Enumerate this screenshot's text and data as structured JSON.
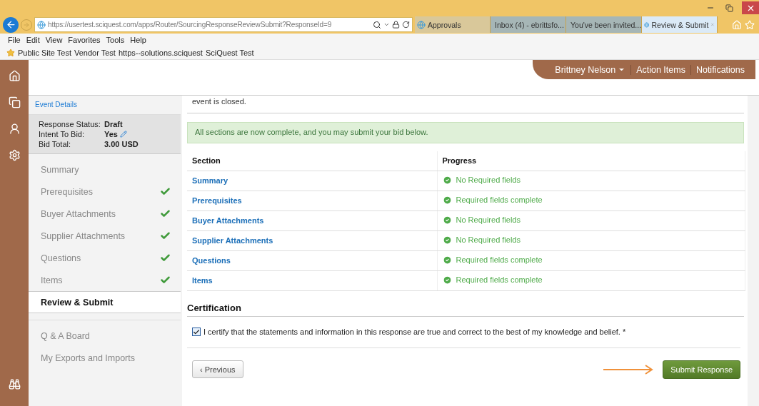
{
  "browser": {
    "address": "https://usertest.sciquest.com/apps/Router/SourcingResponseReviewSubmit?ResponseId=9",
    "tabs": [
      {
        "label": "Approvals",
        "kind": "ie",
        "selected": false
      },
      {
        "label": "Inbox (4) - ebrittsfo...",
        "kind": "mail",
        "selected": false
      },
      {
        "label": "You've been invited...",
        "kind": "mail",
        "selected": false
      },
      {
        "label": "Review & Submit",
        "kind": "ie",
        "selected": true
      }
    ],
    "menu": [
      "File",
      "Edit",
      "View",
      "Favorites",
      "Tools",
      "Help"
    ],
    "favorites": [
      "Public Site Test",
      "Vendor Test",
      "https--solutions.sciquest",
      "SciQuest Test"
    ]
  },
  "header": {
    "user": "Brittney Nelson",
    "links": [
      "Action Items",
      "Notifications"
    ]
  },
  "sidebar": {
    "event_details": "Event Details",
    "status": [
      {
        "label": "Response Status:",
        "value": "Draft",
        "editable": false
      },
      {
        "label": "Intent To Bid:",
        "value": "Yes",
        "editable": true
      },
      {
        "label": "Bid Total:",
        "value": "3.00 USD",
        "editable": false
      }
    ],
    "steps": [
      {
        "label": "Summary",
        "complete": false,
        "selected": false
      },
      {
        "label": "Prerequisites",
        "complete": true,
        "selected": false
      },
      {
        "label": "Buyer Attachments",
        "complete": true,
        "selected": false
      },
      {
        "label": "Supplier Attachments",
        "complete": true,
        "selected": false
      },
      {
        "label": "Questions",
        "complete": true,
        "selected": false
      },
      {
        "label": "Items",
        "complete": true,
        "selected": false
      },
      {
        "label": "Review & Submit",
        "complete": false,
        "selected": true
      }
    ],
    "links": [
      "Q & A Board",
      "My Exports and Imports"
    ]
  },
  "main": {
    "intro": "event is closed.",
    "alert": "All sections are now complete, and you may submit your bid below.",
    "table": {
      "columns": [
        "Section",
        "Progress"
      ],
      "rows": [
        {
          "section": "Summary",
          "progress": "No Required fields"
        },
        {
          "section": "Prerequisites",
          "progress": "Required fields complete"
        },
        {
          "section": "Buyer Attachments",
          "progress": "No Required fields"
        },
        {
          "section": "Supplier Attachments",
          "progress": "No Required fields"
        },
        {
          "section": "Questions",
          "progress": "Required fields complete"
        },
        {
          "section": "Items",
          "progress": "Required fields complete"
        }
      ]
    },
    "certification": {
      "heading": "Certification",
      "label": "I certify that the statements and information in this response are true and correct to the best of my knowledge and belief. *",
      "checked": true
    },
    "previous_button": "‹ Previous",
    "submit_button": "Submit Response"
  }
}
